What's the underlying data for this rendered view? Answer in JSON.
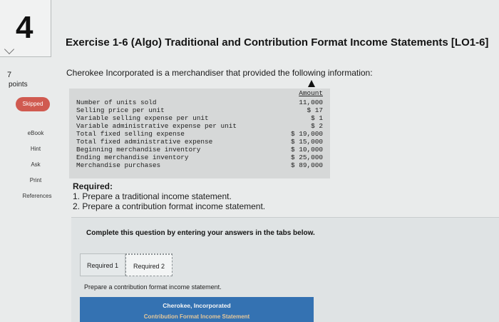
{
  "question": {
    "number": "4",
    "points_value": "7",
    "points_label": "points",
    "status": "Skipped"
  },
  "sidebar": {
    "items": [
      "eBook",
      "Hint",
      "Ask",
      "Print",
      "References"
    ]
  },
  "exercise": {
    "title": "Exercise 1-6 (Algo) Traditional and Contribution Format Income Statements [LO1-6]",
    "intro": "Cherokee Incorporated is a merchandiser that provided the following information:"
  },
  "info_table": {
    "header": "Amount",
    "rows": [
      {
        "label": "Number of units sold",
        "value": "11,000"
      },
      {
        "label": "Selling price per unit",
        "value": "$ 17"
      },
      {
        "label": "Variable selling expense per unit",
        "value": "$ 1"
      },
      {
        "label": "Variable administrative expense per unit",
        "value": "$ 2"
      },
      {
        "label": "Total fixed selling expense",
        "value": "$ 19,000"
      },
      {
        "label": "Total fixed administrative expense",
        "value": "$ 15,000"
      },
      {
        "label": "Beginning merchandise inventory",
        "value": "$ 10,000"
      },
      {
        "label": "Ending merchandise inventory",
        "value": "$ 25,000"
      },
      {
        "label": "Merchandise purchases",
        "value": "$ 89,000"
      }
    ]
  },
  "required": {
    "heading": "Required:",
    "items": [
      "1. Prepare a traditional income statement.",
      "2. Prepare a contribution format income statement."
    ]
  },
  "answer_area": {
    "instructions": "Complete this question by entering your answers in the tabs below.",
    "tabs": [
      "Required 1",
      "Required 2"
    ],
    "active_tab": "Required 2",
    "prompt": "Prepare a contribution format income statement.",
    "statement_company": "Cherokee, Incorporated",
    "statement_title": "Contribution Format Income Statement"
  },
  "colors": {
    "skipped_badge": "#d05a50",
    "statement_header": "#3472b2"
  }
}
